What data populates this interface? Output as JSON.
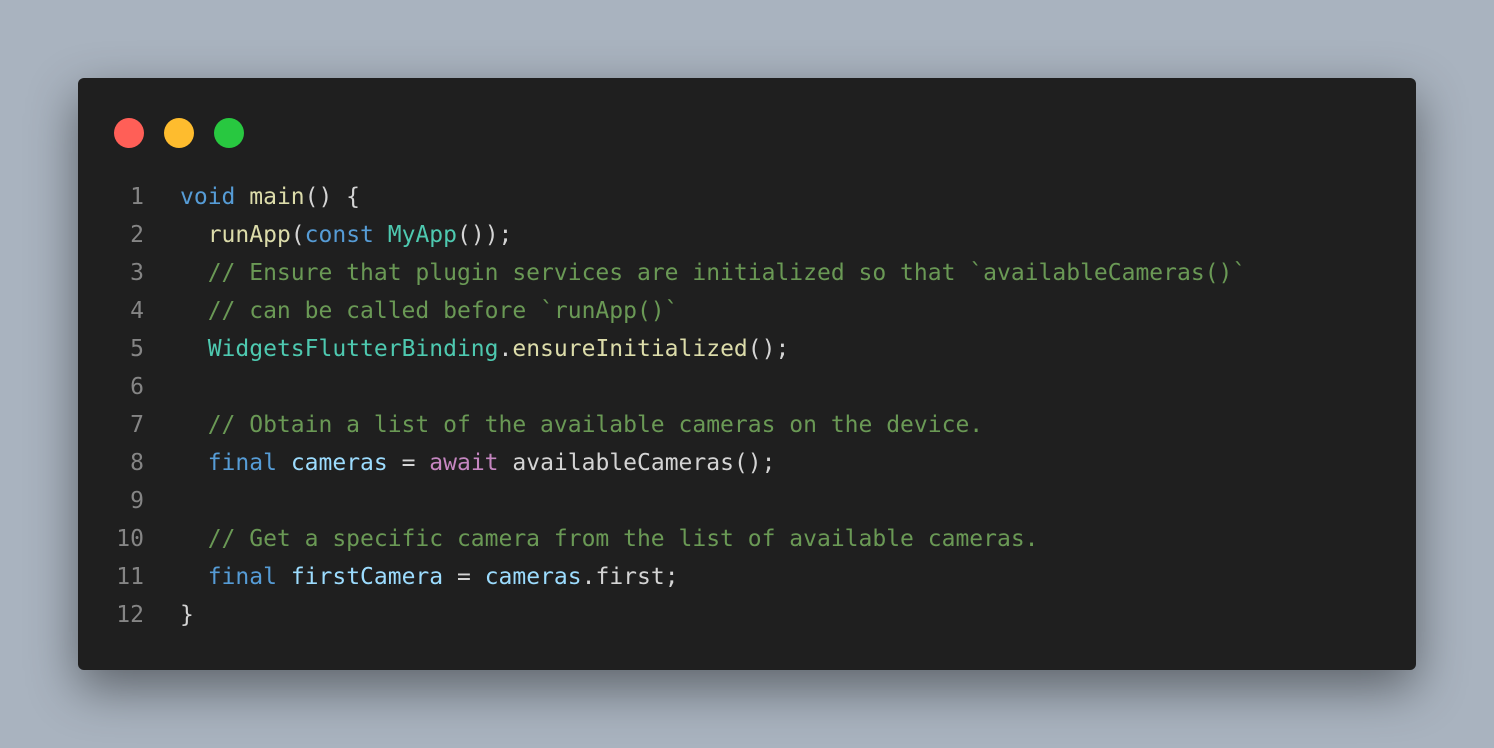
{
  "window": {
    "buttons": [
      {
        "name": "close",
        "color": "#ff5f57"
      },
      {
        "name": "minimize",
        "color": "#febc2e"
      },
      {
        "name": "maximize",
        "color": "#28c840"
      }
    ]
  },
  "code": {
    "language": "dart",
    "lines": [
      {
        "n": "1",
        "tokens": [
          [
            "kw",
            "void"
          ],
          [
            "pl",
            " "
          ],
          [
            "fn",
            "main"
          ],
          [
            "pl",
            "() {"
          ]
        ]
      },
      {
        "n": "2",
        "tokens": [
          [
            "pl",
            "  "
          ],
          [
            "fn",
            "runApp"
          ],
          [
            "pl",
            "("
          ],
          [
            "kw",
            "const"
          ],
          [
            "pl",
            " "
          ],
          [
            "ty",
            "MyApp"
          ],
          [
            "pl",
            "());"
          ]
        ]
      },
      {
        "n": "3",
        "tokens": [
          [
            "cm",
            "  // Ensure that plugin services are initialized so that `availableCameras()`"
          ]
        ]
      },
      {
        "n": "4",
        "tokens": [
          [
            "cm",
            "  // can be called before `runApp()`"
          ]
        ]
      },
      {
        "n": "5",
        "tokens": [
          [
            "pl",
            "  "
          ],
          [
            "ty",
            "WidgetsFlutterBinding"
          ],
          [
            "pl",
            "."
          ],
          [
            "fn",
            "ensureInitialized"
          ],
          [
            "pl",
            "();"
          ]
        ]
      },
      {
        "n": "6",
        "tokens": []
      },
      {
        "n": "7",
        "tokens": [
          [
            "cm",
            "  // Obtain a list of the available cameras on the device."
          ]
        ]
      },
      {
        "n": "8",
        "tokens": [
          [
            "pl",
            "  "
          ],
          [
            "kw",
            "final"
          ],
          [
            "pl",
            " "
          ],
          [
            "vr",
            "cameras"
          ],
          [
            "pl",
            " = "
          ],
          [
            "ctl",
            "await"
          ],
          [
            "pl",
            " availableCameras();"
          ]
        ]
      },
      {
        "n": "9",
        "tokens": []
      },
      {
        "n": "10",
        "tokens": [
          [
            "cm",
            "  // Get a specific camera from the list of available cameras."
          ]
        ]
      },
      {
        "n": "11",
        "tokens": [
          [
            "pl",
            "  "
          ],
          [
            "kw",
            "final"
          ],
          [
            "pl",
            " "
          ],
          [
            "vr",
            "firstCamera"
          ],
          [
            "pl",
            " = "
          ],
          [
            "vr",
            "cameras"
          ],
          [
            "pl",
            ".first;"
          ]
        ]
      },
      {
        "n": "12",
        "tokens": [
          [
            "pl",
            "}"
          ]
        ]
      }
    ]
  }
}
